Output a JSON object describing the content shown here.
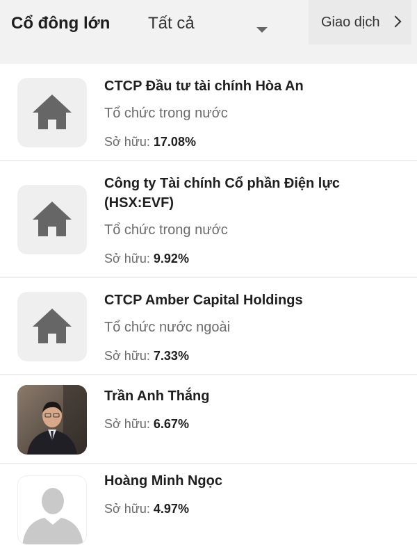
{
  "header": {
    "title": "Cổ đông lớn",
    "filter_value": "Tất cả",
    "trade_label": "Giao dịch"
  },
  "shareholders": [
    {
      "name": "CTCP Đầu tư tài chính Hòa An",
      "type": "Tổ chức trong nước",
      "ownership_label": "Sở hữu:",
      "ownership": "17.08%",
      "icon": "building-icon"
    },
    {
      "name": "Công ty Tài chính Cổ phần Điện lực (HSX:EVF)",
      "type": "Tổ chức trong nước",
      "ownership_label": "Sở hữu:",
      "ownership": "9.92%",
      "icon": "building-icon"
    },
    {
      "name": "CTCP Amber Capital Holdings",
      "type": "Tổ chức nước ngoài",
      "ownership_label": "Sở hữu:",
      "ownership": "7.33%",
      "icon": "building-icon"
    },
    {
      "name": "Trần Anh Thắng",
      "ownership_label": "Sở hữu:",
      "ownership": "6.67%",
      "icon": "person-photo"
    },
    {
      "name": "Hoàng Minh Ngọc",
      "ownership_label": "Sở hữu:",
      "ownership": "4.97%",
      "icon": "person-silhouette-icon"
    }
  ],
  "colors": {
    "header_bg": "#f2f2f2",
    "icon_gray": "#666666",
    "text_primary": "#1e1e1e",
    "text_secondary": "#6b6b6b"
  }
}
